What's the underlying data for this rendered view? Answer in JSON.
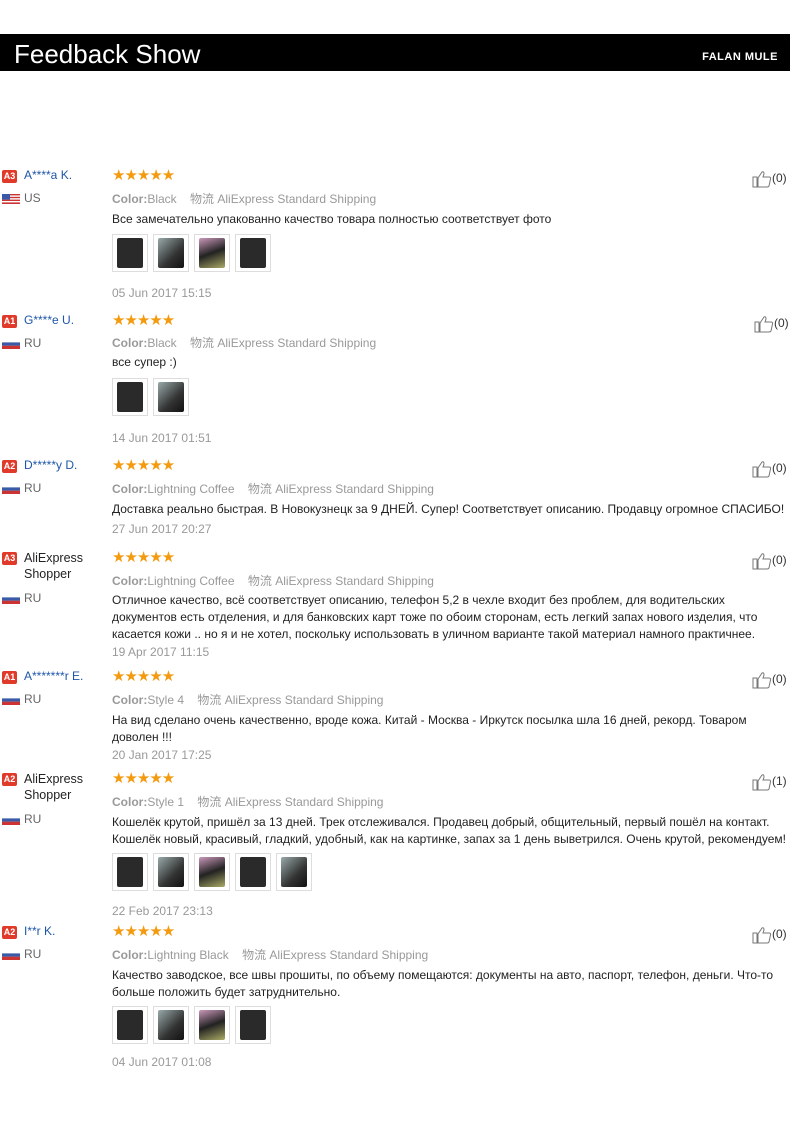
{
  "header": {
    "title": "Feedback Show",
    "brand": "FALAN MULE"
  },
  "labels": {
    "color": "Color:",
    "shipping_prefix": "物流"
  },
  "reviews": [
    {
      "badge": "A3",
      "name": "A****a K.",
      "country": "US",
      "flag": "us",
      "rating": 5,
      "color": "Black",
      "shipping": "AliExpress Standard Shipping",
      "text": "Все замечательно упакованно качество товара полностью соответствует фото",
      "photos": 4,
      "date": "05 Jun 2017 15:15",
      "likes": "(0)"
    },
    {
      "badge": "A1",
      "name": "G****e U.",
      "country": "RU",
      "flag": "ru",
      "rating": 5,
      "color": "Black",
      "shipping": "AliExpress Standard Shipping",
      "text": "все супер :)",
      "photos": 2,
      "date": "14 Jun 2017 01:51",
      "likes": "(0)"
    },
    {
      "badge": "A2",
      "name": "D*****y D.",
      "country": "RU",
      "flag": "ru",
      "rating": 5,
      "color": "Lightning Coffee",
      "shipping": "AliExpress Standard Shipping",
      "text": "Доставка реально быстрая. В Новокузнецк за 9 ДНЕЙ. Супер! Соответствует описанию. Продавцу огромное СПАСИБО!",
      "photos": 0,
      "date": "27 Jun 2017 20:27",
      "likes": "(0)"
    },
    {
      "badge": "A3",
      "name": "AliExpress Shopper",
      "country": "RU",
      "flag": "ru",
      "rating": 5,
      "color": "Lightning Coffee",
      "shipping": "AliExpress Standard Shipping",
      "text": "Отличное качество, всё соответствует описанию, телефон 5,2 в чехле входит без проблем, для водительских документов есть отделения, и для банковских карт тоже по обоим сторонам, есть легкий запах нового изделия, что касается кожи .. но я и не хотел, поскольку использовать в уличном варианте такой материал намного практичнее.",
      "photos": 0,
      "date": "19 Apr 2017 11:15",
      "likes": "(0)"
    },
    {
      "badge": "A1",
      "name": "A*******r E.",
      "country": "RU",
      "flag": "ru",
      "rating": 5,
      "color": "Style 4",
      "shipping": "AliExpress Standard Shipping",
      "text": "На вид сделано очень качественно, вроде кожа. Китай - Москва - Иркутск посылка шла 16 дней, рекорд. Товаром доволен !!!",
      "photos": 0,
      "date": "20 Jan 2017 17:25",
      "likes": "(0)"
    },
    {
      "badge": "A2",
      "name": "AliExpress Shopper",
      "country": "RU",
      "flag": "ru",
      "rating": 5,
      "color": "Style 1",
      "shipping": "AliExpress Standard Shipping",
      "text": "Кошелёк крутой, пришёл за 13 дней. Трек отслеживался. Продавец добрый, общительный, первый пошёл на контакт. Кошелёк новый, красивый, гладкий, удобный, как на картинке, запах за 1 день выветрился. Очень крутой, рекомендуем!",
      "photos": 5,
      "date": "22 Feb 2017 23:13",
      "likes": "(1)"
    },
    {
      "badge": "A2",
      "name": "I**r K.",
      "country": "RU",
      "flag": "ru",
      "rating": 5,
      "color": "Lightning Black",
      "shipping": "AliExpress Standard Shipping",
      "text": "Качество заводское, все швы прошиты, по объему помещаются: документы на авто, паспорт, телефон, деньги. Что-то больше положить будет затруднительно.",
      "photos": 4,
      "date": "04 Jun 2017 01:08",
      "likes": "(0)"
    }
  ],
  "colors": {
    "accent_star": "#f39a0f",
    "badge": "#e03a2a",
    "name_link": "#1d56a8"
  }
}
